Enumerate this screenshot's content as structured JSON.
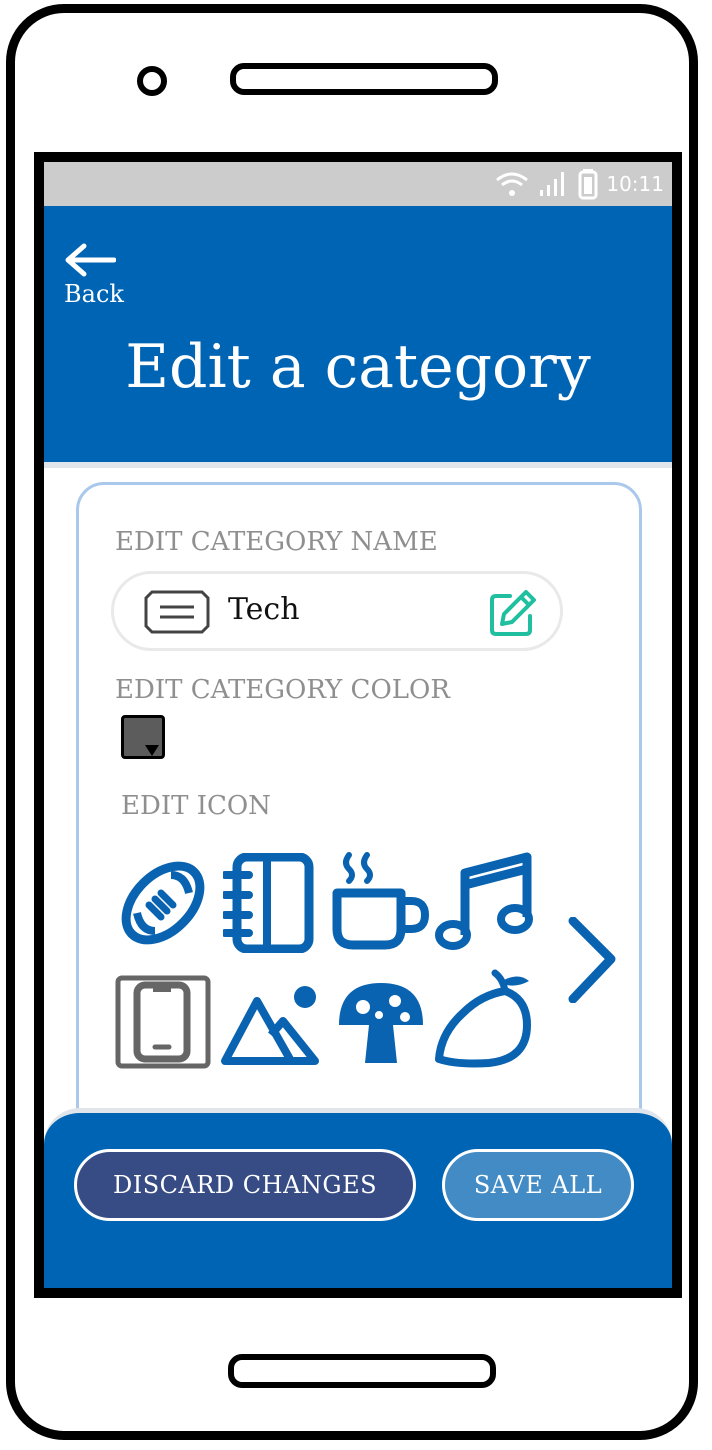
{
  "status_bar": {
    "time": "10:11",
    "icons": [
      "wifi-icon",
      "signal-icon",
      "battery-icon"
    ]
  },
  "header": {
    "back_label": "Back",
    "title": "Edit a category"
  },
  "form": {
    "name_section_label": "EDIT CATEGORY NAME",
    "name_value": "Tech",
    "color_section_label": "EDIT CATEGORY COLOR",
    "selected_color": "#5c5c5c",
    "icon_section_label": "EDIT ICON",
    "icons": [
      {
        "name": "football-icon",
        "selected": false
      },
      {
        "name": "notebook-icon",
        "selected": false
      },
      {
        "name": "coffee-cup-icon",
        "selected": false
      },
      {
        "name": "music-note-icon",
        "selected": false
      },
      {
        "name": "smartphone-icon",
        "selected": true
      },
      {
        "name": "mountain-image-icon",
        "selected": false
      },
      {
        "name": "mushroom-icon",
        "selected": false
      },
      {
        "name": "mango-icon",
        "selected": false
      }
    ]
  },
  "footer": {
    "discard_label": "DISCARD CHANGES",
    "save_label": "SAVE ALL"
  },
  "colors": {
    "primary": "#0064b4",
    "icon_blue": "#0a63b0",
    "edit_accent": "#1fbf9f",
    "discard_bg": "#374c85",
    "save_bg": "#428bc4"
  }
}
